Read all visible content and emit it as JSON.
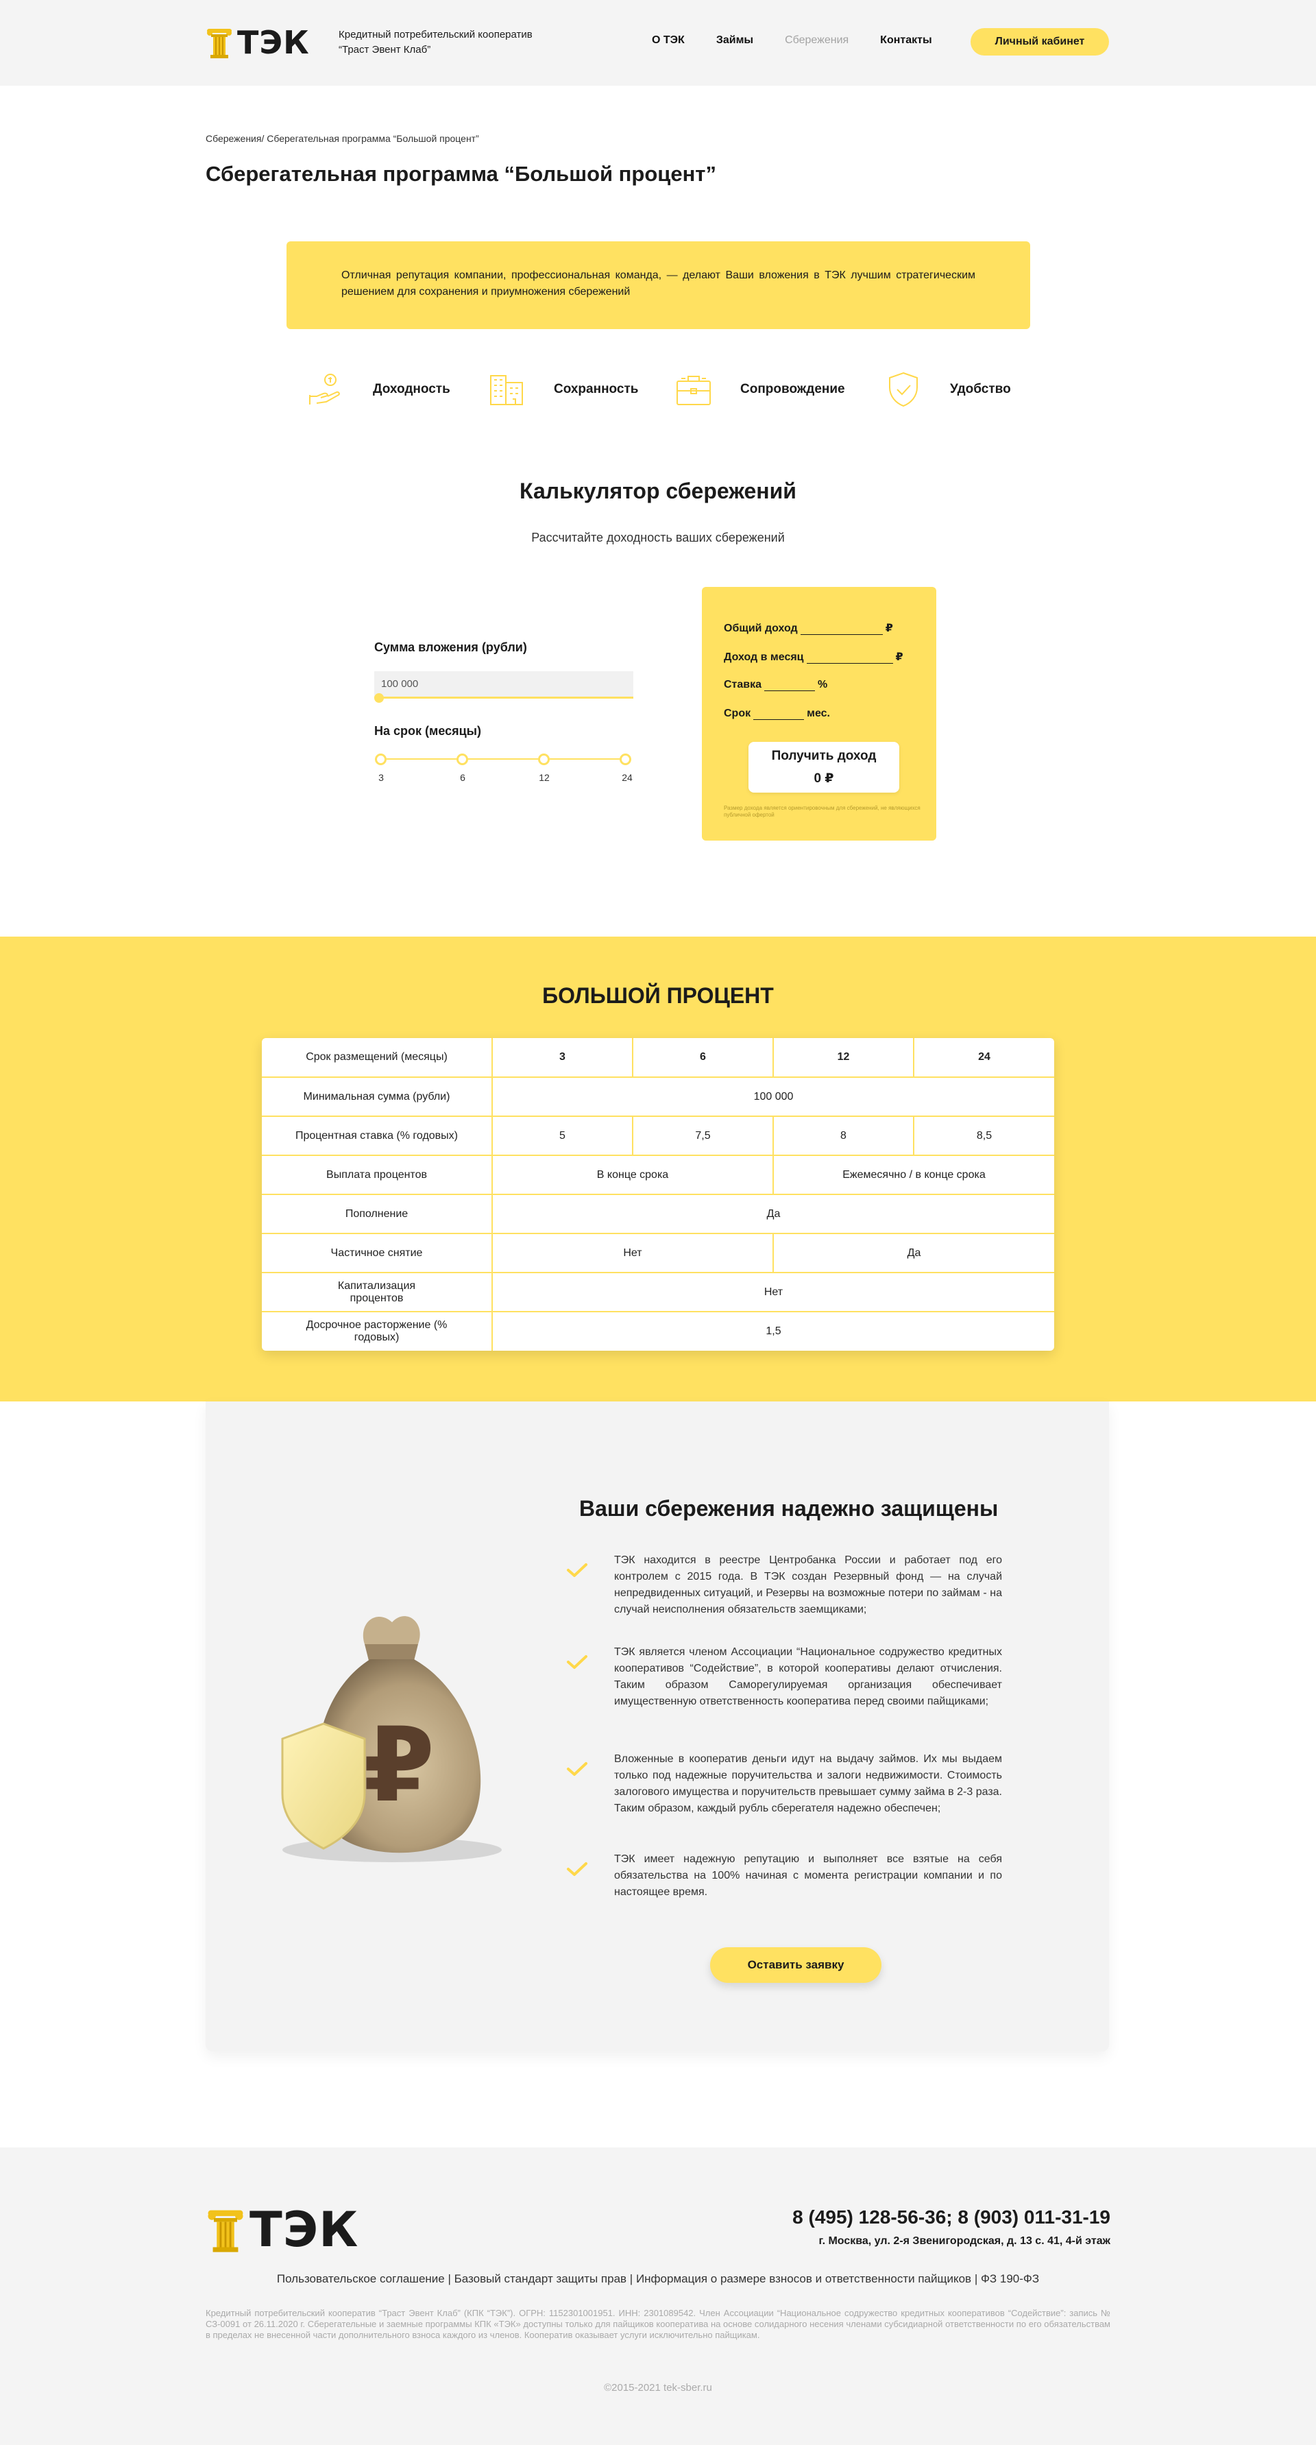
{
  "colors": {
    "accent": "#ffe161",
    "text": "#1b1b1b",
    "muted": "#a3a3a3",
    "background_grey": "#f4f4f4"
  },
  "header": {
    "logo_text": "ТЭК",
    "tagline_1": "Кредитный потребительский кооператив",
    "tagline_2": "“Траст Эвент Клаб”",
    "nav": [
      "О ТЭК",
      "Займы",
      "Сбережения",
      "Контакты"
    ],
    "active_nav": "Сбережения",
    "cabinet_label": "Личный кабинет"
  },
  "page": {
    "breadcrumb": "Сбережения/ Сберегательная программа “Большой процент”",
    "title": "Сберегательная программа “Большой процент”",
    "intro": "Отличная репутация компании, профессиональная команда, — делают Ваши вложения в ТЭК лучшим стратегическим решением для сохранения и приумножения сбережений"
  },
  "features": [
    {
      "icon": "hand-coin-icon",
      "label": "Доходность"
    },
    {
      "icon": "building-icon",
      "label": "Сохранность"
    },
    {
      "icon": "briefcase-icon",
      "label": "Сопровождение"
    },
    {
      "icon": "shield-check-icon",
      "label": "Удобство"
    }
  ],
  "calculator": {
    "title": "Калькулятор сбережений",
    "subtitle": "Рассчитайте доходность ваших сбережений",
    "sum_label": "Сумма вложения (рубли)",
    "sum_value": "100 000",
    "term_label": "На срок (месяцы)",
    "term_options": [
      "3",
      "6",
      "12",
      "24"
    ],
    "result": {
      "total_label": "Общий доход",
      "total_unit": "₽",
      "monthly_label": "Доход в месяц",
      "monthly_unit": "₽",
      "rate_label": "Ставка",
      "rate_unit": "%",
      "term_label": "Срок",
      "term_unit": "мес.",
      "button_label": "Получить доход",
      "button_value": "0 ₽",
      "note": "Размер дохода является ориентировочным для сбережений, не являющихся публичной офертой"
    }
  },
  "program_table": {
    "title": "БОЛЬШОЙ ПРОЦЕНТ",
    "rows": {
      "term": {
        "label": "Срок размещений (месяцы)",
        "values": [
          "3",
          "6",
          "12",
          "24"
        ]
      },
      "min_sum": {
        "label": "Минимальная сумма (рубли)",
        "value": "100 000"
      },
      "rate": {
        "label": "Процентная ставка (% годовых)",
        "values": [
          "5",
          "7,5",
          "8",
          "8,5"
        ]
      },
      "payout": {
        "label": "Выплата процентов",
        "left": "В конце срока",
        "right": "Ежемесячно / в конце срока"
      },
      "replenish": {
        "label": "Пополнение",
        "value": "Да"
      },
      "partial": {
        "label": "Частичное снятие",
        "left": "Нет",
        "right": "Да"
      },
      "capitalization": {
        "label": "Капитализация процентов",
        "value": "Нет"
      },
      "early": {
        "label": "Досрочное расторжение (% годовых)",
        "value": "1,5"
      }
    }
  },
  "protection": {
    "title": "Ваши сбережения надежно защищены",
    "items": [
      "ТЭК находится в реестре Центробанка России и работает под его контролем с 2015 года. В ТЭК создан Резервный фонд — на случай непредвиденных ситуаций, и Резервы на возможные потери по займам - на случай неисполнения обязательств заемщиками;",
      "ТЭК является членом Ассоциации “Национальное содружество кредитных кооперативов “Содействие”, в которой кооперативы делают отчисления. Таким образом Саморегулируемая организация обеспечивает имущественную ответственность кооператива перед своими пайщиками;",
      "Вложенные в кооператив деньги идут на выдачу займов. Их мы выдаем только под надежные поручительства и залоги недвижимости. Стоимость залогового имущества и поручительств превышает сумму займа в 2-3 раза. Таким образом, каждый рубль сберегателя надежно обеспечен;",
      "ТЭК имеет надежную репутацию и выполняет все взятые на себя обязательства на 100% начиная с момента регистрации компании и по настоящее время."
    ],
    "button_label": "Оставить заявку"
  },
  "footer": {
    "logo_text": "ТЭК",
    "phones": "8 (495) 128-56-36;   8 (903) 011-31-19",
    "address": "г. Москва, ул. 2-я Звенигородская, д. 13 с. 41, 4-й этаж",
    "links": [
      "Пользовательское соглашение",
      "Базовый стандарт защиты прав",
      "Информация о размере взносов и ответственности пайщиков",
      "ФЗ 190-ФЗ"
    ],
    "legal": "Кредитный потребительский кооператив “Траст Эвент Клаб” (КПК “ТЭК”). ОГРН: 1152301001951. ИНН: 2301089542. Член Ассоциации “Национальное содружество кредитных кооперативов “Содействие”: запись № СЗ-0091 от 26.11.2020 г. Сберегательные и заемные программы КПК «ТЭК» доступны только для пайщиков кооператива на основе солидарного несения членами субсидиарной ответственности по его обязательствам в пределах не внесенной части дополнительного взноса каждого из членов. Кооператив оказывает услуги исключительно пайщикам.",
    "copyright": "©2015-2021 tek-sber.ru"
  }
}
